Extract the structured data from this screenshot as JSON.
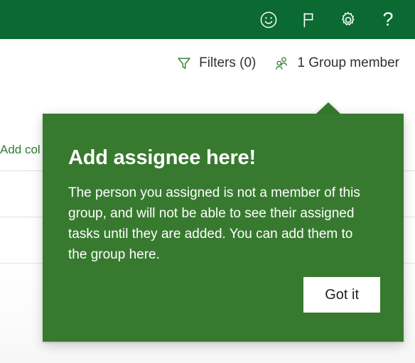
{
  "suite_header": {
    "background_color": "#0b6a31",
    "actions": [
      {
        "name": "feedback-smiley-icon",
        "label": "Feedback"
      },
      {
        "name": "flag-icon",
        "label": "What's new"
      },
      {
        "name": "gear-icon",
        "label": "Settings"
      },
      {
        "name": "help-icon",
        "label": "?"
      }
    ]
  },
  "command_bar": {
    "filters": {
      "label": "Filters (0)",
      "icon": "filter-funnel-icon",
      "count": 0
    },
    "group_members": {
      "label": "1 Group member",
      "icon": "people-icon",
      "count": 1
    },
    "icon_color": "#2e7d32"
  },
  "board": {
    "add_column_label": "Add col",
    "add_column_color": "#2e7d32",
    "row_divider_color": "#e1dfdd"
  },
  "callout": {
    "title": "Add assignee here!",
    "body": "The person you assigned is not a member of this group, and will not be able to see their assigned tasks until they are added. You can add them to the group here.",
    "primary_button_label": "Got it",
    "background_color": "#377a2f",
    "text_color": "#ffffff",
    "button_background": "#ffffff",
    "button_text_color": "#201f1e"
  }
}
